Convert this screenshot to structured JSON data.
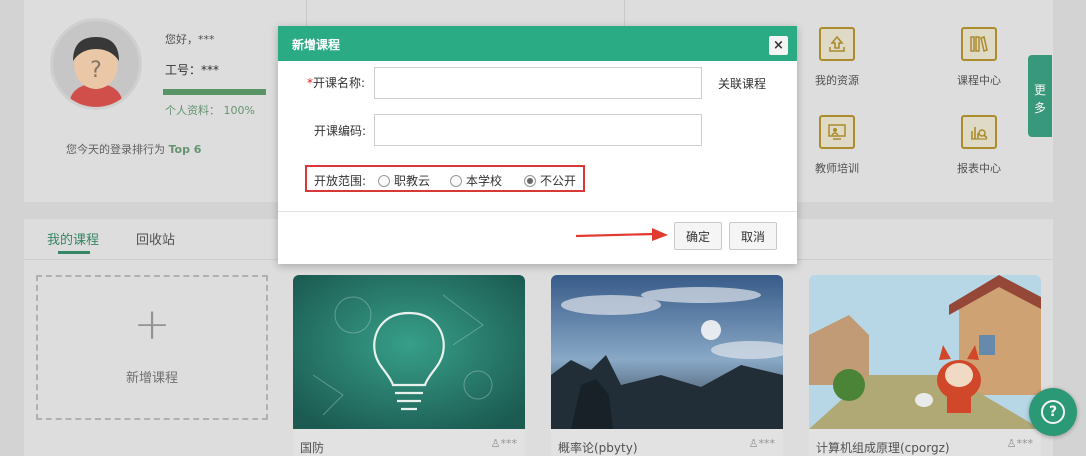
{
  "profile": {
    "greeting": "您好，***",
    "employee_no": "工号：***",
    "completeness": "个人资料： 100%",
    "completeness_value": 1.0,
    "rank_text": "您今天的登录排行为",
    "rank_value": "Top 6"
  },
  "quick_links": [
    {
      "label": "我的资源",
      "icon": "upload-icon"
    },
    {
      "label": "课程中心",
      "icon": "books-icon"
    },
    {
      "label": "教师培训",
      "icon": "teacher-icon"
    },
    {
      "label": "报表中心",
      "icon": "report-chart-icon"
    }
  ],
  "more_tab": "更\n多",
  "tabs": {
    "my_courses": "我的课程",
    "recycle_bin": "回收站"
  },
  "add_course": {
    "plus": "+",
    "label": "新增课程"
  },
  "courses": [
    {
      "title": "国防",
      "owner": "***"
    },
    {
      "title": "概率论(pbyty)",
      "owner": "***"
    },
    {
      "title": "计算机组成原理(cporgz)",
      "owner": "***"
    }
  ],
  "help": "?",
  "modal": {
    "title": "新增课程",
    "close": "×",
    "name_required": "*",
    "name_label": "开课名称:",
    "name_value": "",
    "link_course": "关联课程",
    "code_label": "开课编码:",
    "code_value": "",
    "scope_label": "开放范围:",
    "scope_options": [
      "职教云",
      "本学校",
      "不公开"
    ],
    "scope_selected": "不公开",
    "ok": "确定",
    "cancel": "取消"
  },
  "colors": {
    "accent": "#2aab84",
    "highlight_red": "#d93838",
    "icon_gold": "#b3912f"
  }
}
